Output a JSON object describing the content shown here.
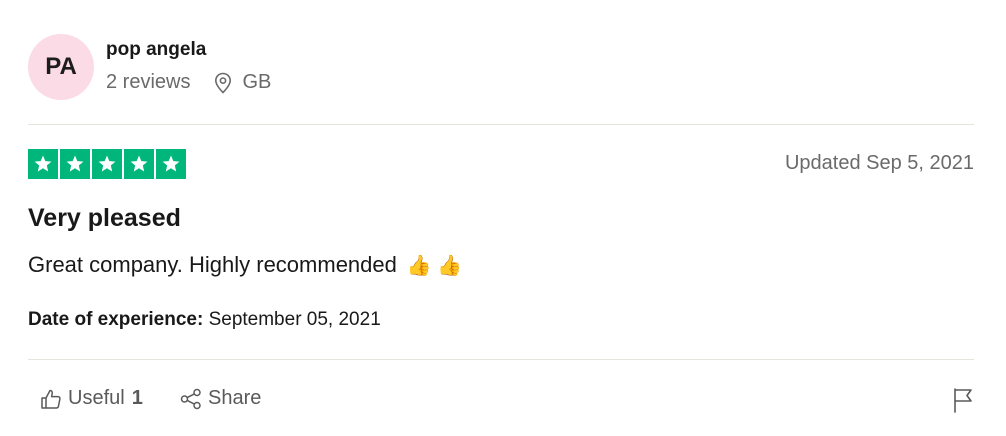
{
  "review": {
    "author": {
      "initials": "PA",
      "name": "pop angela",
      "reviews_count": "2 reviews",
      "location": "GB",
      "avatar_color": "#fbdbe5"
    },
    "rating": {
      "stars": 5,
      "max": 5,
      "color": "#00b67a"
    },
    "updated": "Updated Sep 5, 2021",
    "title": "Very pleased",
    "body": "Great company. Highly recommended",
    "emoji": "👍 👍",
    "experience_label": "Date of experience:",
    "experience_date": "September 05, 2021"
  },
  "footer": {
    "useful_label": "Useful",
    "useful_count": "1",
    "share_label": "Share",
    "icons": {
      "useful": "thumbs-up-icon",
      "share": "share-icon",
      "flag": "flag-icon",
      "location": "location-pin-icon"
    }
  }
}
